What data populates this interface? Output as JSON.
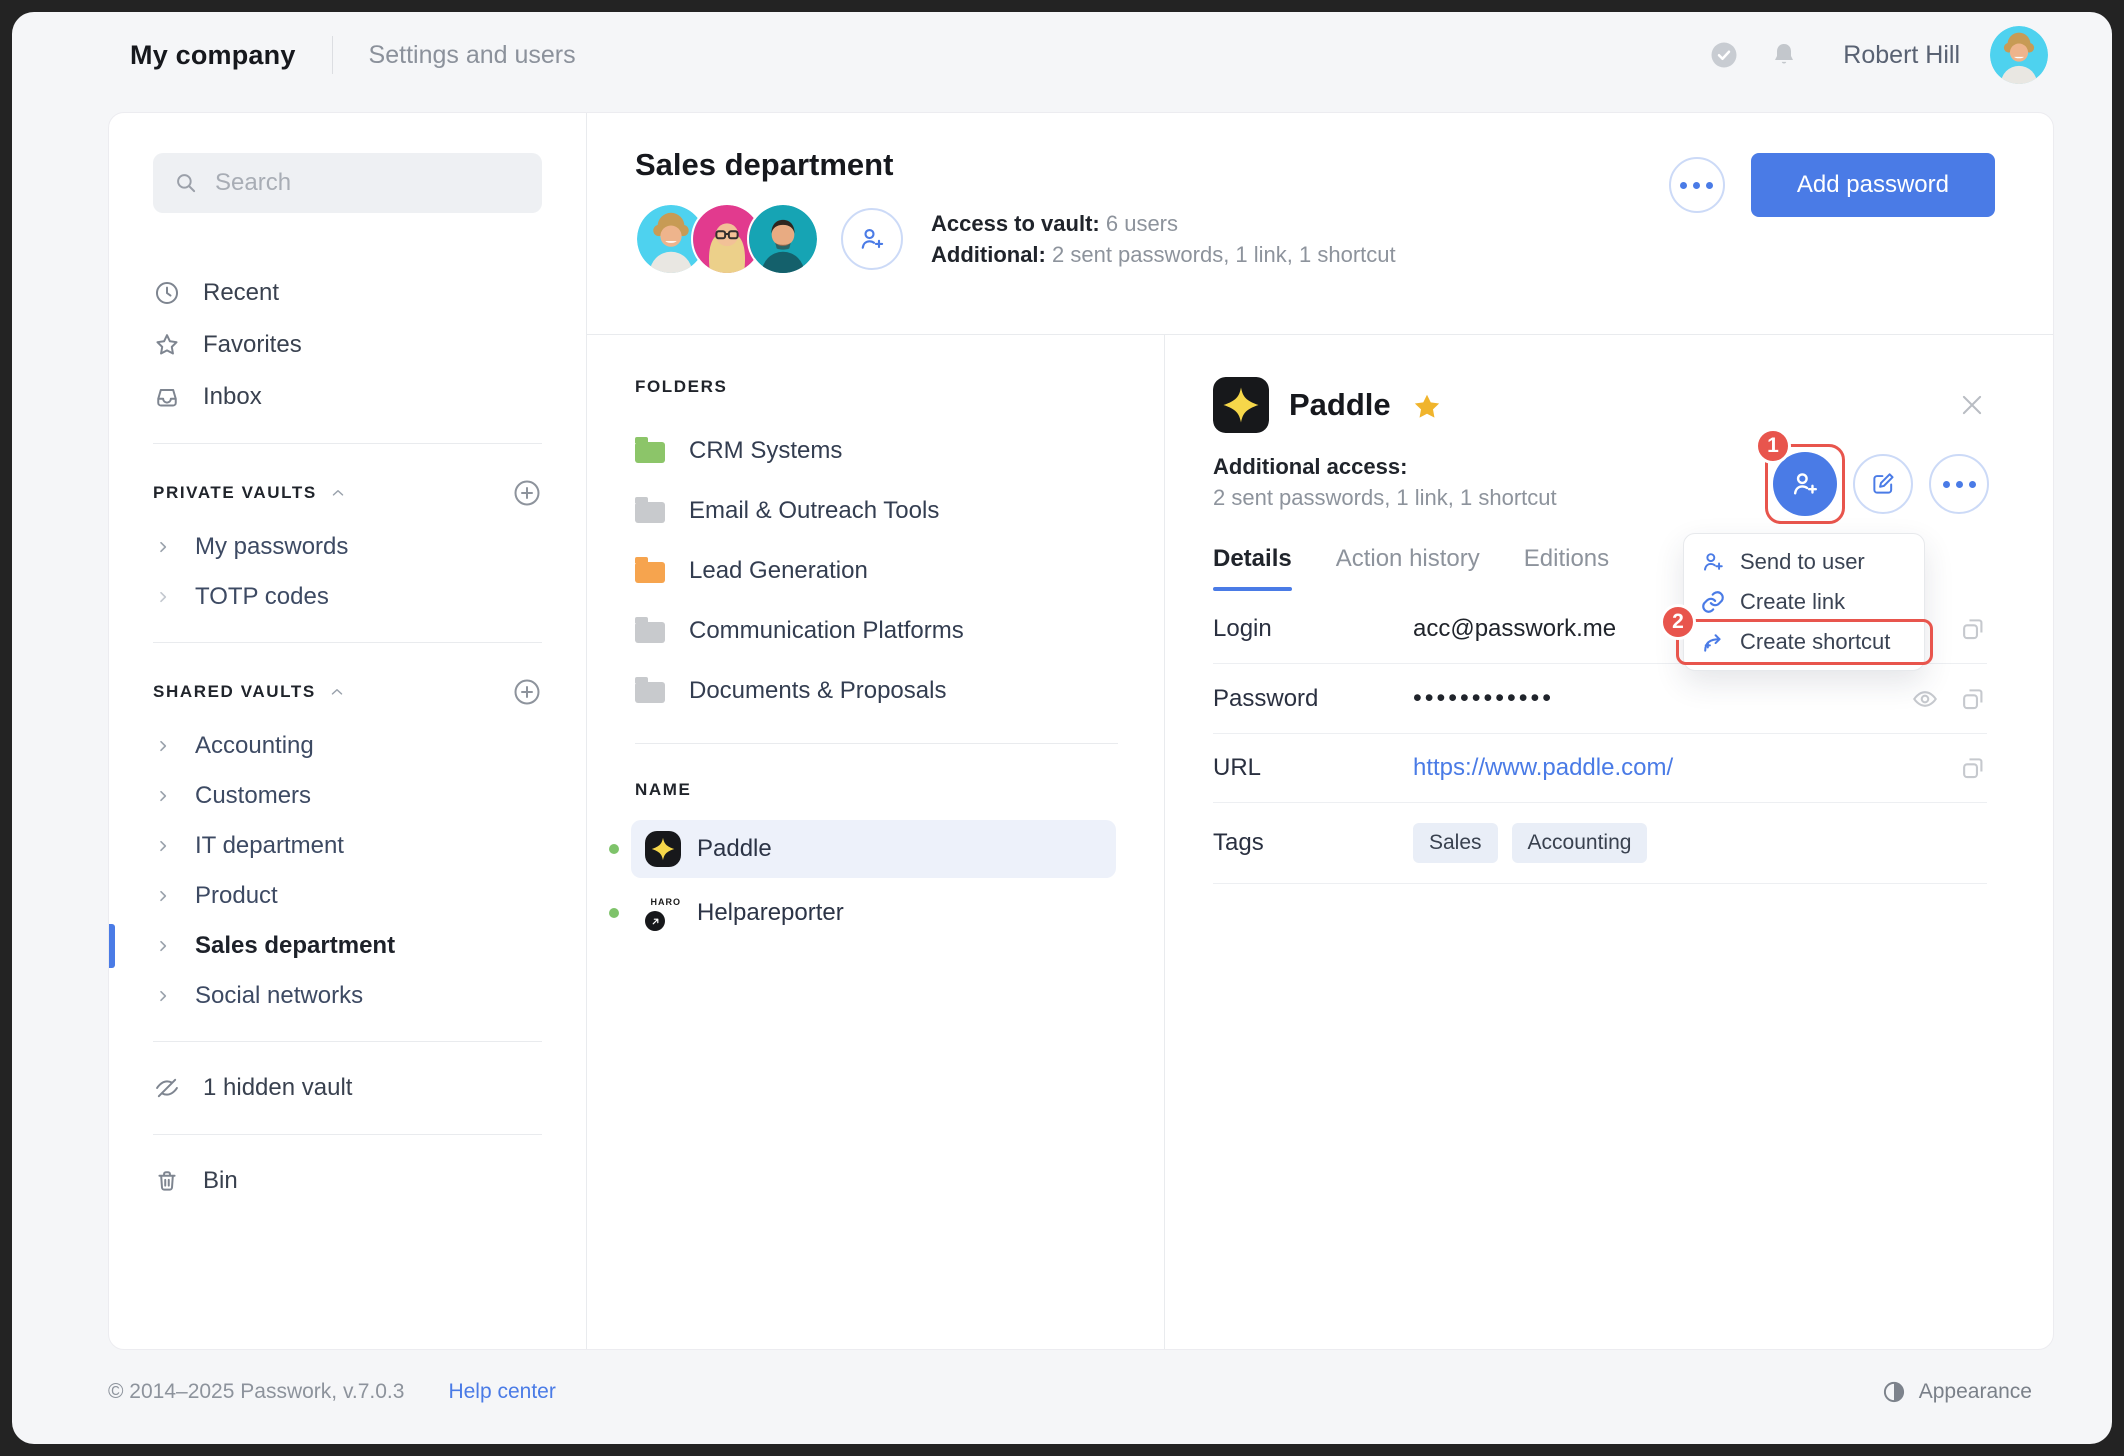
{
  "topbar": {
    "company": "My company",
    "section": "Settings and users",
    "user": "Robert Hill"
  },
  "sidebar": {
    "search_placeholder": "Search",
    "nav": [
      {
        "label": "Recent"
      },
      {
        "label": "Favorites"
      },
      {
        "label": "Inbox"
      }
    ],
    "private_vaults": {
      "title": "PRIVATE VAULTS",
      "items": [
        "My passwords",
        "TOTP codes"
      ]
    },
    "shared_vaults": {
      "title": "SHARED VAULTS",
      "items": [
        "Accounting",
        "Customers",
        "IT department",
        "Product",
        "Sales department",
        "Social networks"
      ],
      "active": "Sales department"
    },
    "hidden_vaults": "1 hidden vault",
    "bin": "Bin"
  },
  "vault_header": {
    "title": "Sales department",
    "access_label": "Access to vault:",
    "access_value": "6 users",
    "additional_label": "Additional:",
    "additional_value": "2 sent passwords, 1 link, 1 shortcut",
    "add_password": "Add password"
  },
  "folders": {
    "title": "FOLDERS",
    "items": [
      {
        "name": "CRM Systems",
        "color": "#8cc569"
      },
      {
        "name": "Email & Outreach Tools",
        "color": "#c8cacd"
      },
      {
        "name": "Lead Generation",
        "color": "#f6a44e"
      },
      {
        "name": "Communication Platforms",
        "color": "#c8cacd"
      },
      {
        "name": "Documents & Proposals",
        "color": "#c8cacd"
      }
    ]
  },
  "passwords": {
    "title": "NAME",
    "items": [
      {
        "name": "Paddle",
        "selected": true,
        "logo_text": ""
      },
      {
        "name": "Helpareporter",
        "selected": false,
        "logo_text": "HARO"
      }
    ]
  },
  "detail": {
    "title": "Paddle",
    "additional_access_label": "Additional access:",
    "additional_access_value": "2 sent passwords, 1 link, 1 shortcut",
    "tabs": [
      "Details",
      "Action history",
      "Editions"
    ],
    "active_tab": "Details",
    "fields": {
      "login_label": "Login",
      "login": "acc@passwork.me",
      "password_label": "Password",
      "password_mask": "••••••••••••",
      "url_label": "URL",
      "url": "https://www.paddle.com/",
      "tags_label": "Tags",
      "tags": [
        "Sales",
        "Accounting"
      ]
    },
    "menu": {
      "items": [
        "Send to user",
        "Create link",
        "Create shortcut"
      ]
    },
    "annotations": {
      "step1": "1",
      "step2": "2"
    }
  },
  "footer": {
    "copyright": "© 2014–2025 Passwork, v.7.0.3",
    "help": "Help center",
    "appearance": "Appearance"
  },
  "colors": {
    "accent_blue": "#4a7be6",
    "annotation_red": "#e8554d",
    "selected_row_bg": "#edf1fa",
    "tag_bg": "#e9eef7",
    "favorite_gold": "#f0b42c",
    "paddle_star_yellow": "#f6d74a",
    "online_dot_green": "#7ec36a",
    "folder_green": "#8cc569",
    "folder_orange": "#f6a44e",
    "folder_gray": "#c8cacd",
    "avatar_bg_cyan": "#4ed2ef",
    "avatar_bg_pink": "#e23a8e",
    "avatar_bg_teal": "#16a4b4"
  },
  "icons": {
    "topbar": [
      "check-circle-icon",
      "bell-icon"
    ],
    "sidebar": [
      "search-icon",
      "clock-icon",
      "star-icon",
      "inbox-icon",
      "chevron-up-icon",
      "plus-circle-icon",
      "chevron-right-icon",
      "eye-off-icon",
      "trash-icon"
    ],
    "detail": [
      "favorite-star-icon",
      "close-icon",
      "user-add-icon",
      "edit-icon",
      "more-icon",
      "eye-icon",
      "copy-icon",
      "link-icon",
      "shortcut-icon"
    ],
    "footer": [
      "appearance-icon"
    ]
  }
}
